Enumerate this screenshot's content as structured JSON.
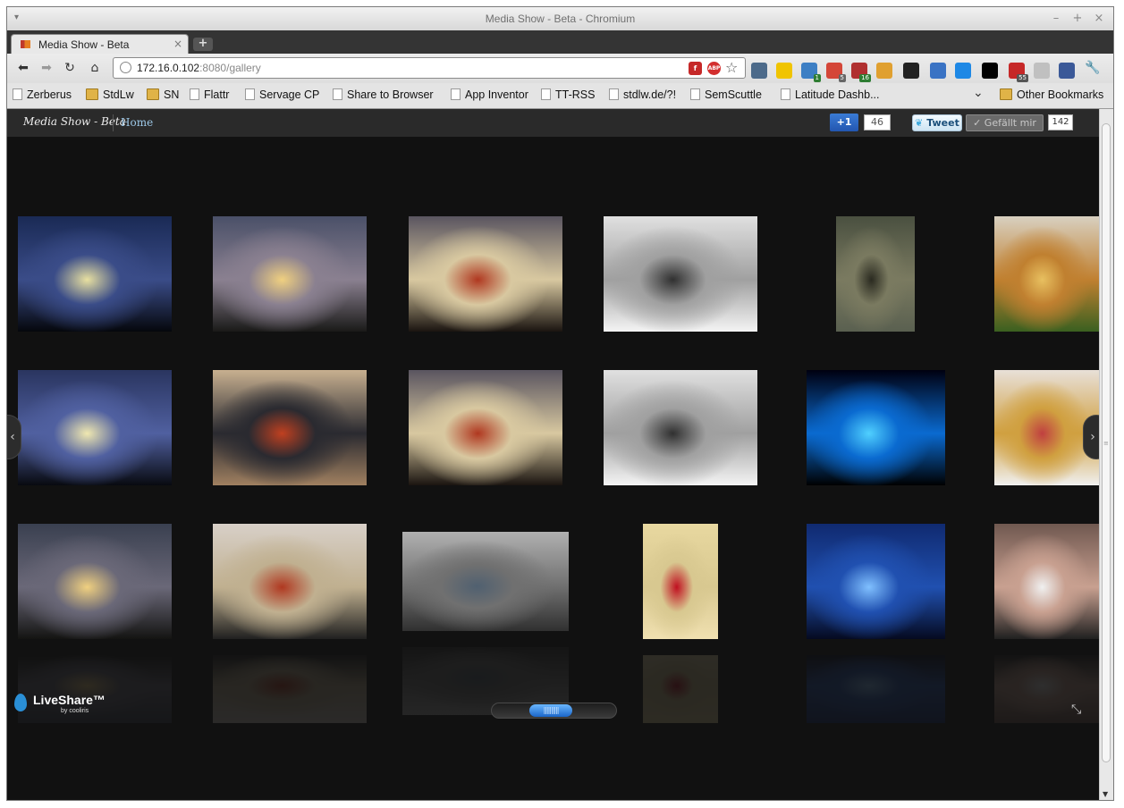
{
  "window": {
    "title": "Media Show - Beta - Chromium",
    "menu_glyph": "▾",
    "min_glyph": "–",
    "max_glyph": "+",
    "close_glyph": "×"
  },
  "tab": {
    "label": "Media Show - Beta",
    "close_glyph": "×",
    "new_tab_glyph": "+"
  },
  "nav": {
    "back": "⬅",
    "forward": "➡",
    "reload": "↻",
    "home": "⌂"
  },
  "address": {
    "host": "172.16.0.102",
    "rest": ":8080/gallery",
    "star_glyph": "☆",
    "wrench_glyph": "🔧"
  },
  "omnibox_icons": [
    {
      "name": "flash-icon",
      "text": "f",
      "color": "#c62828"
    },
    {
      "name": "adblock-plus-icon",
      "text": "ABP",
      "color": "#d32f2f"
    }
  ],
  "extensions": [
    {
      "name": "clock-extension-icon",
      "color": "#4c6a8a",
      "badge": ""
    },
    {
      "name": "phone-extension-icon",
      "color": "#f0c400",
      "badge": ""
    },
    {
      "name": "robot-extension-icon",
      "color": "#3d7fc4",
      "badge": "1",
      "badge_color": "#2e7d32"
    },
    {
      "name": "gmail-extension-icon",
      "color": "#d44638",
      "badge": "5",
      "badge_color": "#666"
    },
    {
      "name": "feeds-extension-icon",
      "color": "#b03030",
      "badge": "16",
      "badge_color": "#2e7d32"
    },
    {
      "name": "tamper-extension-icon",
      "color": "#e0a030",
      "badge": ""
    },
    {
      "name": "color-picker-extension-icon",
      "color": "#222",
      "badge": ""
    },
    {
      "name": "chrome-extension-icon",
      "color": "#3a73c4",
      "badge": ""
    },
    {
      "name": "gear-extension-icon",
      "color": "#1e88e5",
      "badge": ""
    },
    {
      "name": "instapaper-extension-icon",
      "color": "#000",
      "badge": ""
    },
    {
      "name": "checklist-extension-icon",
      "color": "#c62828",
      "badge": "55",
      "badge_color": "#555"
    },
    {
      "name": "mail-extension-icon",
      "color": "#c0c0c0",
      "badge": ""
    },
    {
      "name": "facebook-extension-icon",
      "color": "#3b5998",
      "badge": ""
    }
  ],
  "bookmarks": [
    {
      "label": "Zerberus",
      "icon": "page"
    },
    {
      "label": "StdLw",
      "icon": "folder"
    },
    {
      "label": "SN",
      "icon": "folder"
    },
    {
      "label": "Flattr",
      "icon": "page"
    },
    {
      "label": "Servage CP",
      "icon": "page"
    },
    {
      "label": "Share to Browser",
      "icon": "page"
    },
    {
      "label": "App Inventor",
      "icon": "page"
    },
    {
      "label": "TT-RSS",
      "icon": "page"
    },
    {
      "label": "stdlw.de/?!",
      "icon": "page"
    },
    {
      "label": "SemScuttle",
      "icon": "page"
    },
    {
      "label": "Latitude Dashb...",
      "icon": "page"
    }
  ],
  "bookmarks_more": "⌄",
  "other_bookmarks": "Other Bookmarks",
  "app": {
    "brand": "Media Show - Beta",
    "home_link": "Home",
    "gplus_label": "+1",
    "gplus_count": "46",
    "tweet_label": "Tweet",
    "fb_like_label": "✓ Gefällt mir",
    "fb_count": "142"
  },
  "gallery": {
    "prev_glyph": "‹",
    "next_glyph": "›",
    "photos": [
      {
        "name": "photo-sunset-1",
        "colors": [
          "#1a2a55",
          "#3a4c88",
          "#e8e0a0",
          "#05070c"
        ]
      },
      {
        "name": "photo-sunset-house-1",
        "colors": [
          "#4a5068",
          "#8a8090",
          "#f0d080",
          "#1a1a18"
        ]
      },
      {
        "name": "photo-bottle-tube-1",
        "colors": [
          "#5a5560",
          "#d8c8a0",
          "#b03820",
          "#1a1410"
        ]
      },
      {
        "name": "photo-device-1",
        "colors": [
          "#e0e0e0",
          "#a0a0a0",
          "#303030",
          "#f4f4f4"
        ]
      },
      {
        "name": "photo-book-cover",
        "colors": [
          "#4a5040",
          "#7a7a60",
          "#2a2a20",
          "#5a6050"
        ]
      },
      {
        "name": "photo-food-croissant",
        "colors": [
          "#d8d0c0",
          "#c08030",
          "#e8c060",
          "#3a6020"
        ]
      },
      {
        "name": "photo-sunset-2",
        "colors": [
          "#2a3560",
          "#5060a0",
          "#f0e8b0",
          "#080a10"
        ]
      },
      {
        "name": "photo-bottle-tube-2",
        "colors": [
          "#c8b090",
          "#2a2a30",
          "#c04020",
          "#a08060"
        ]
      },
      {
        "name": "photo-bottle-tube-3",
        "colors": [
          "#5a5560",
          "#d8c8a0",
          "#b03820",
          "#1a1410"
        ]
      },
      {
        "name": "photo-device-2",
        "colors": [
          "#e0e0e0",
          "#a0a0a0",
          "#303030",
          "#f4f4f4"
        ]
      },
      {
        "name": "photo-blue-energy",
        "colors": [
          "#000010",
          "#0a6ad0",
          "#50d0ff",
          "#000000"
        ]
      },
      {
        "name": "photo-food-fries",
        "colors": [
          "#e8e0d8",
          "#d0a040",
          "#c04040",
          "#f0f0f0"
        ]
      },
      {
        "name": "photo-sunset-house-2",
        "colors": [
          "#3a4050",
          "#6a6878",
          "#f0d080",
          "#141412"
        ]
      },
      {
        "name": "photo-tube-bottle-4",
        "colors": [
          "#d8d0c8",
          "#c0b090",
          "#b03820",
          "#202020"
        ]
      },
      {
        "name": "photo-street-car",
        "colors": [
          "#b0b0b0",
          "#707070",
          "#506070",
          "#303030"
        ]
      },
      {
        "name": "photo-red-seal-card",
        "colors": [
          "#e8d8a0",
          "#d8c890",
          "#c01020",
          "#f0e0b0"
        ]
      },
      {
        "name": "photo-lightning-desert",
        "colors": [
          "#102a70",
          "#2050b0",
          "#80c0ff",
          "#050a20"
        ]
      },
      {
        "name": "photo-woman-bottle",
        "colors": [
          "#705850",
          "#c8a090",
          "#f0f0f0",
          "#202020"
        ]
      }
    ]
  },
  "liveshare": {
    "title": "LiveShare™",
    "subtitle": "by cooliris"
  },
  "slider": {
    "knob_text": "||||||||||",
    "position": 0.45
  },
  "fullscreen_glyph": "⤡"
}
